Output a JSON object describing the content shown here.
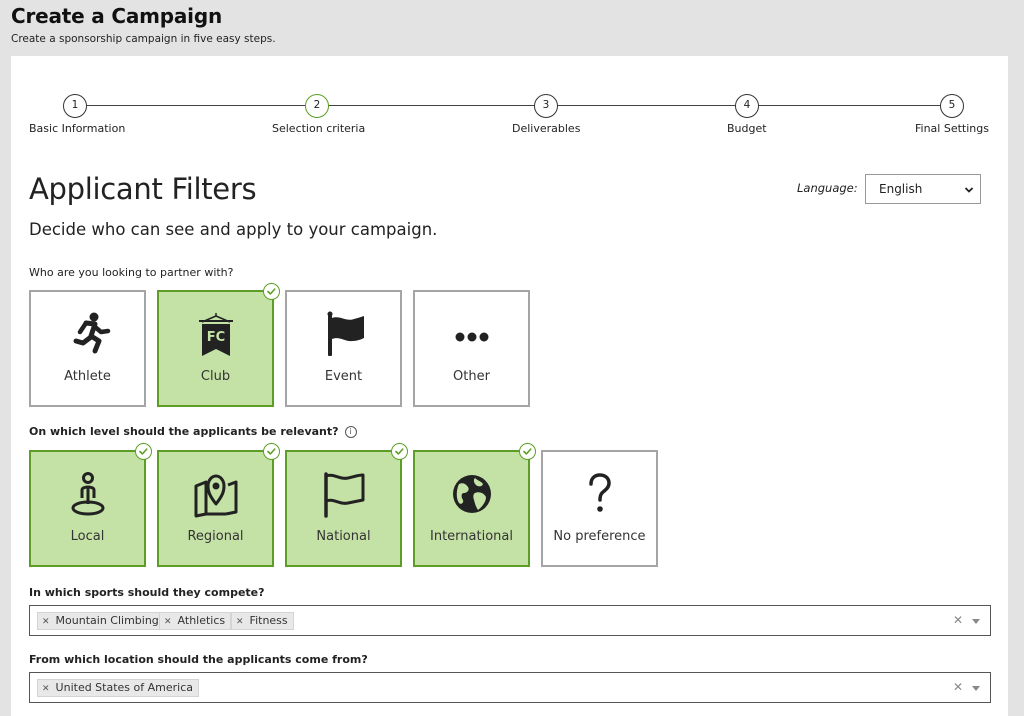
{
  "header": {
    "title": "Create a Campaign",
    "subtitle": "Create a sponsorship campaign in five easy steps."
  },
  "stepper": {
    "active_step": 2,
    "steps": [
      {
        "number": "1",
        "label": "Basic Information"
      },
      {
        "number": "2",
        "label": "Selection criteria"
      },
      {
        "number": "3",
        "label": "Deliverables"
      },
      {
        "number": "4",
        "label": "Budget"
      },
      {
        "number": "5",
        "label": "Final Settings"
      }
    ]
  },
  "section": {
    "title": "Applicant Filters",
    "subtitle": "Decide who can see and apply to your campaign."
  },
  "language": {
    "label": "Language:",
    "selected": "English"
  },
  "partner_question": {
    "label": "Who are you looking to partner with?",
    "options": [
      {
        "label": "Athlete",
        "icon": "running-person-icon",
        "selected": false
      },
      {
        "label": "Club",
        "icon": "club-pennant-icon",
        "badge_text": "FC",
        "selected": true
      },
      {
        "label": "Event",
        "icon": "flag-icon",
        "selected": false
      },
      {
        "label": "Other",
        "icon": "more-dots-icon",
        "selected": false
      }
    ]
  },
  "level_question": {
    "label": "On which level should the applicants be relevant?",
    "info_icon": "info-icon",
    "options": [
      {
        "label": "Local",
        "icon": "location-person-icon",
        "selected": true
      },
      {
        "label": "Regional",
        "icon": "map-pin-icon",
        "selected": true
      },
      {
        "label": "National",
        "icon": "flag-outline-icon",
        "selected": true
      },
      {
        "label": "International",
        "icon": "globe-icon",
        "selected": true
      },
      {
        "label": "No preference",
        "icon": "question-mark-icon",
        "selected": false
      }
    ]
  },
  "sports_question": {
    "label": "In which sports should they compete?",
    "chips": [
      "Mountain Climbing",
      "Athletics",
      "Fitness"
    ]
  },
  "location_question": {
    "label": "From which location should the applicants come from?",
    "chips": [
      "United States of America"
    ]
  },
  "colors": {
    "selected_bg": "#c5e2a6",
    "selected_border": "#5e9e26",
    "page_bg": "#e3e3e3"
  }
}
